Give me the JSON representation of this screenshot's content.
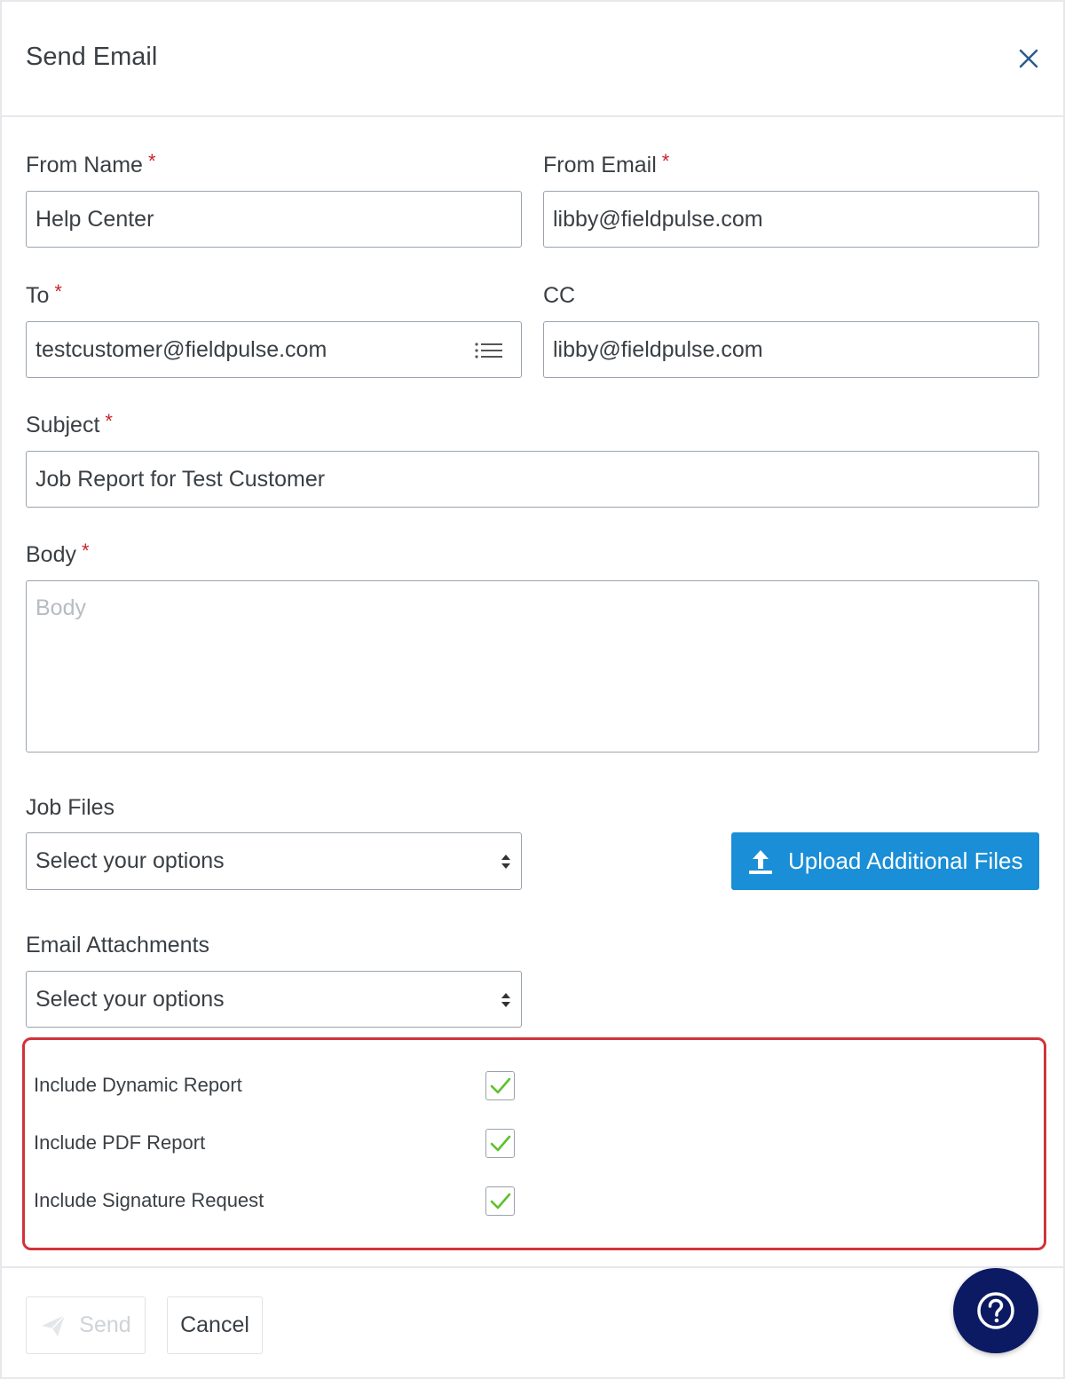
{
  "dialog": {
    "title": "Send Email",
    "close_icon": "close-icon"
  },
  "form": {
    "from_name": {
      "label": "From Name",
      "required": "*",
      "value": "Help Center"
    },
    "from_email": {
      "label": "From Email",
      "required": "*",
      "value": "libby@fieldpulse.com"
    },
    "to": {
      "label": "To",
      "required": "*",
      "value": "testcustomer@fieldpulse.com",
      "icon": "list-icon"
    },
    "cc": {
      "label": "CC",
      "value": "libby@fieldpulse.com"
    },
    "subject": {
      "label": "Subject",
      "required": "*",
      "value": "Job Report for Test Customer"
    },
    "body": {
      "label": "Body",
      "required": "*",
      "placeholder": "Body",
      "value": ""
    },
    "job_files": {
      "label": "Job Files",
      "selected": "Select your options"
    },
    "email_attachments": {
      "label": "Email Attachments",
      "selected": "Select your options"
    },
    "upload_button": {
      "label": "Upload Additional Files",
      "icon": "upload-icon"
    }
  },
  "options": [
    {
      "label": "Include Dynamic Report",
      "checked": true
    },
    {
      "label": "Include PDF Report",
      "checked": true
    },
    {
      "label": "Include Signature Request",
      "checked": true
    }
  ],
  "footer": {
    "send_label": "Send",
    "send_icon": "paper-plane-icon",
    "cancel_label": "Cancel",
    "help_icon": "question-circle-icon"
  },
  "colors": {
    "primary": "#1a8ed6",
    "required": "#c8232c",
    "highlight": "#d0333b",
    "check": "#5cc22a",
    "help_bg": "#0b1a63"
  }
}
